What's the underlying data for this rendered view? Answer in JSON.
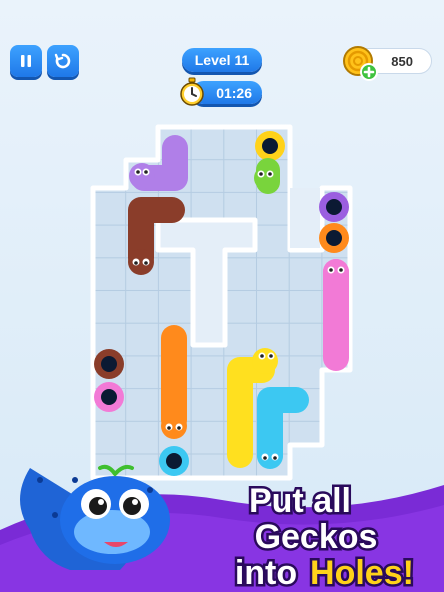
{
  "hud": {
    "pause_icon": "pause-icon",
    "restart_icon": "restart-icon",
    "level_label": "Level 11",
    "timer_value": "01:26",
    "timer_icon": "stopwatch-icon",
    "coins_value": "850",
    "coin_icon": "coin-plus-icon"
  },
  "board": {
    "geckos": [
      {
        "color": "purple",
        "hex": "#b07fe8"
      },
      {
        "color": "brown",
        "hex": "#8a3d2a"
      },
      {
        "color": "green",
        "hex": "#79d43c"
      },
      {
        "color": "pink",
        "hex": "#f27ad6"
      },
      {
        "color": "orange",
        "hex": "#ff8a1c"
      },
      {
        "color": "yellow",
        "hex": "#ffe01f"
      },
      {
        "color": "cyan",
        "hex": "#3cc8f2"
      }
    ],
    "holes": [
      {
        "color": "yellow",
        "hex": "#ffd21a"
      },
      {
        "color": "purple",
        "hex": "#9b5fe0"
      },
      {
        "color": "orange",
        "hex": "#ff8a1c"
      },
      {
        "color": "brown",
        "hex": "#8a3d2a"
      },
      {
        "color": "pink",
        "hex": "#f27ad6"
      },
      {
        "color": "cyan",
        "hex": "#3cc8f2"
      }
    ]
  },
  "promo": {
    "line1": "Put all",
    "line2": "Geckos",
    "line3_white": "into",
    "line3_yellow": "Holes!",
    "mascot": "blue-gecko-mascot"
  }
}
